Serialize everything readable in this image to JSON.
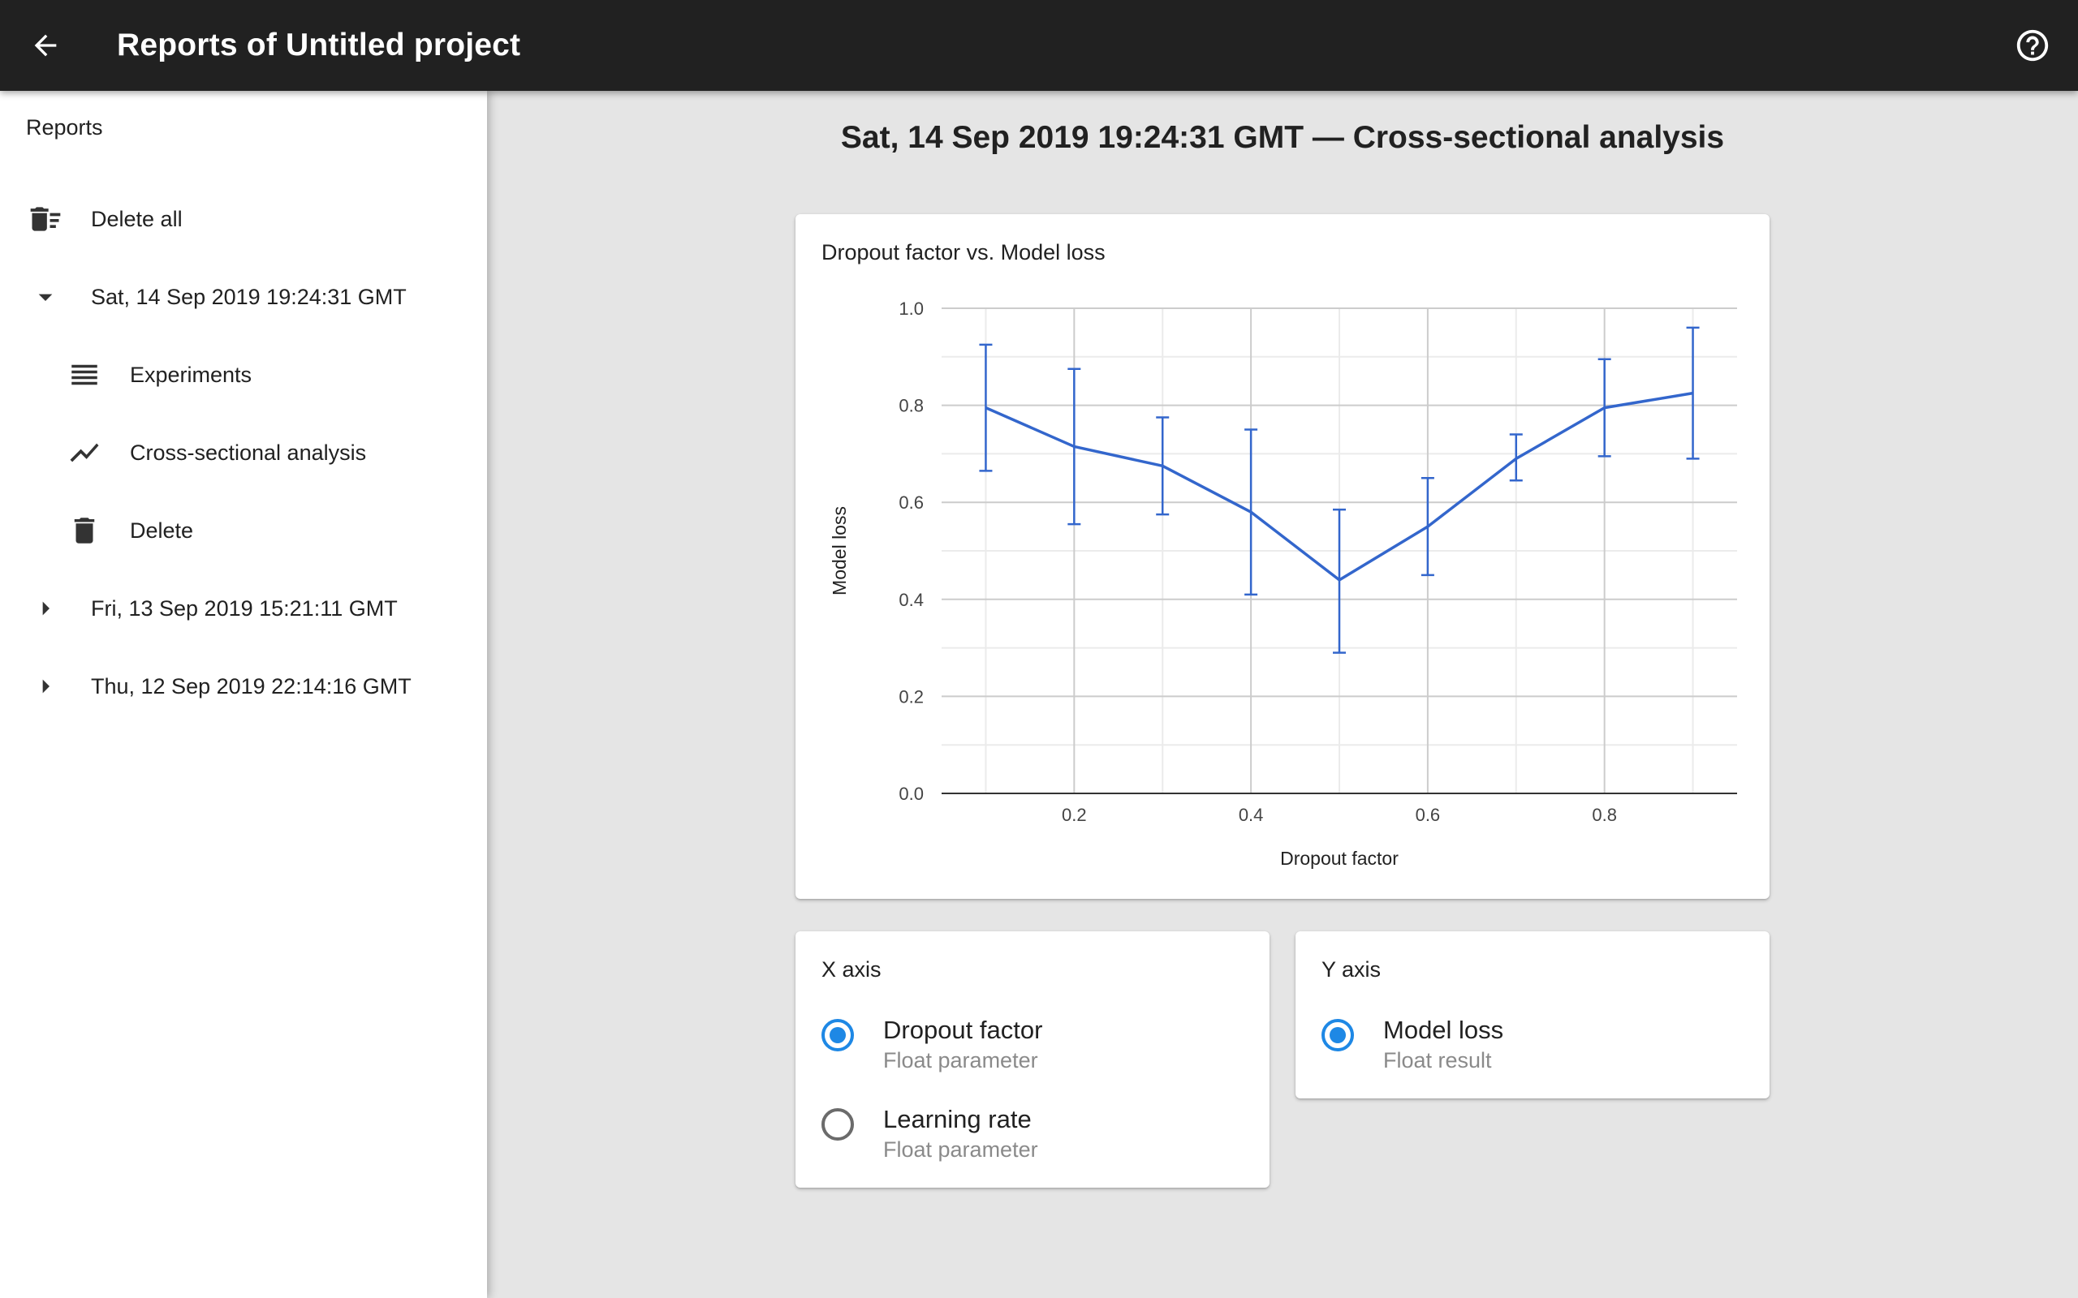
{
  "app": {
    "title": "Reports of Untitled project",
    "back_icon": "arrow-back-icon",
    "help_icon": "help-circle-icon"
  },
  "sidebar": {
    "heading": "Reports",
    "delete_all": "Delete all",
    "reports": [
      {
        "label": "Sat, 14 Sep 2019 19:24:31 GMT",
        "expanded": true,
        "children": [
          {
            "label": "Experiments",
            "icon": "list-icon"
          },
          {
            "label": "Cross-sectional analysis",
            "icon": "trend-line-icon"
          },
          {
            "label": "Delete",
            "icon": "trash-icon"
          }
        ]
      },
      {
        "label": "Fri, 13 Sep 2019 15:21:11 GMT",
        "expanded": false
      },
      {
        "label": "Thu, 12 Sep 2019 22:14:16 GMT",
        "expanded": false
      }
    ]
  },
  "main": {
    "title": "Sat, 14 Sep 2019 19:24:31 GMT — Cross-sectional analysis"
  },
  "chart_card": {
    "title": "Dropout factor vs. Model loss"
  },
  "chart_data": {
    "type": "line",
    "title": "Dropout factor vs. Model loss",
    "xlabel": "Dropout factor",
    "ylabel": "Model loss",
    "x_ticks": [
      "0.2",
      "0.4",
      "0.6",
      "0.8"
    ],
    "y_ticks": [
      "0.0",
      "0.2",
      "0.4",
      "0.6",
      "0.8",
      "1.0"
    ],
    "xlim": [
      0.05,
      0.95
    ],
    "ylim": [
      0,
      1.0
    ],
    "grid": true,
    "line_color": "#3366cc",
    "series": [
      {
        "x": [
          0.1,
          0.2,
          0.3,
          0.4,
          0.5,
          0.6,
          0.7,
          0.8,
          0.9
        ],
        "y": [
          0.795,
          0.715,
          0.675,
          0.58,
          0.44,
          0.55,
          0.69,
          0.795,
          0.825
        ],
        "error_low": [
          0.665,
          0.555,
          0.575,
          0.41,
          0.29,
          0.45,
          0.645,
          0.695,
          0.69
        ],
        "error_high": [
          0.925,
          0.875,
          0.775,
          0.75,
          0.585,
          0.65,
          0.74,
          0.895,
          0.96
        ]
      }
    ]
  },
  "x_axis_card": {
    "title": "X axis",
    "options": [
      {
        "label": "Dropout factor",
        "sub": "Float parameter",
        "checked": true
      },
      {
        "label": "Learning rate",
        "sub": "Float parameter",
        "checked": false
      }
    ]
  },
  "y_axis_card": {
    "title": "Y axis",
    "options": [
      {
        "label": "Model loss",
        "sub": "Float result",
        "checked": true
      }
    ]
  },
  "colors": {
    "appbar": "#212121",
    "accent": "#1e88e5",
    "background": "#e5e5e5"
  }
}
